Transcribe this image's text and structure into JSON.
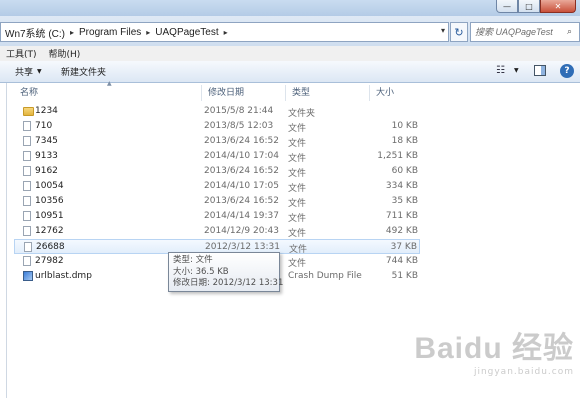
{
  "window": {
    "title_ghost": "",
    "min_icon": "minimize-icon",
    "max_icon": "maximize-icon",
    "close_icon": "close-icon",
    "min_glyph": "—",
    "max_glyph": "□",
    "close_glyph": "✕"
  },
  "address": {
    "crumbs": [
      "Wn7系统 (C:)",
      "Program Files",
      "UAQPageTest"
    ],
    "separator": "▸",
    "dropdown": "▾",
    "refresh_glyph": "↻"
  },
  "search": {
    "placeholder": "搜索 UAQPageTest",
    "icon_glyph": "⌕"
  },
  "menu": {
    "items": [
      "工具(T)",
      "帮助(H)"
    ]
  },
  "toolbar": {
    "share_label": "共享",
    "new_folder_label": "新建文件夹",
    "dropdown_glyph": "▼",
    "view_glyph": "☷",
    "help_glyph": "?"
  },
  "columns": {
    "name": "名称",
    "date": "修改日期",
    "type": "类型",
    "size": "大小"
  },
  "files": [
    {
      "icon": "folder-icon",
      "name": "1234",
      "date": "2015/5/8 21:44",
      "type": "文件夹",
      "size": ""
    },
    {
      "icon": "file-icon",
      "name": "710",
      "date": "2013/8/5 12:03",
      "type": "文件",
      "size": "10 KB"
    },
    {
      "icon": "file-icon",
      "name": "7345",
      "date": "2013/6/24 16:52",
      "type": "文件",
      "size": "18 KB"
    },
    {
      "icon": "file-icon",
      "name": "9133",
      "date": "2014/4/10 17:04",
      "type": "文件",
      "size": "1,251 KB"
    },
    {
      "icon": "file-icon",
      "name": "9162",
      "date": "2013/6/24 16:52",
      "type": "文件",
      "size": "60 KB"
    },
    {
      "icon": "file-icon",
      "name": "10054",
      "date": "2014/4/10 17:05",
      "type": "文件",
      "size": "334 KB"
    },
    {
      "icon": "file-icon",
      "name": "10356",
      "date": "2013/6/24 16:52",
      "type": "文件",
      "size": "35 KB"
    },
    {
      "icon": "file-icon",
      "name": "10951",
      "date": "2014/4/14 19:37",
      "type": "文件",
      "size": "711 KB"
    },
    {
      "icon": "file-icon",
      "name": "12762",
      "date": "2014/12/9 20:43",
      "type": "文件",
      "size": "492 KB"
    },
    {
      "icon": "file-icon",
      "name": "26688",
      "date": "2012/3/12 13:31",
      "type": "文件",
      "size": "37 KB"
    },
    {
      "icon": "file-icon",
      "name": "27982",
      "date": "",
      "type": "文件",
      "size": "744 KB"
    },
    {
      "icon": "app-icon",
      "name": "urlblast.dmp",
      "date": "",
      "type": "Crash Dump File",
      "size": "51 KB"
    }
  ],
  "tooltip": {
    "type_line": "类型: 文件",
    "size_line": "大小: 36.5 KB",
    "date_line": "修改日期: 2012/3/12 13:31"
  },
  "watermark": {
    "logo": "Baidu 经验",
    "url": "jingyan.baidu.com"
  }
}
